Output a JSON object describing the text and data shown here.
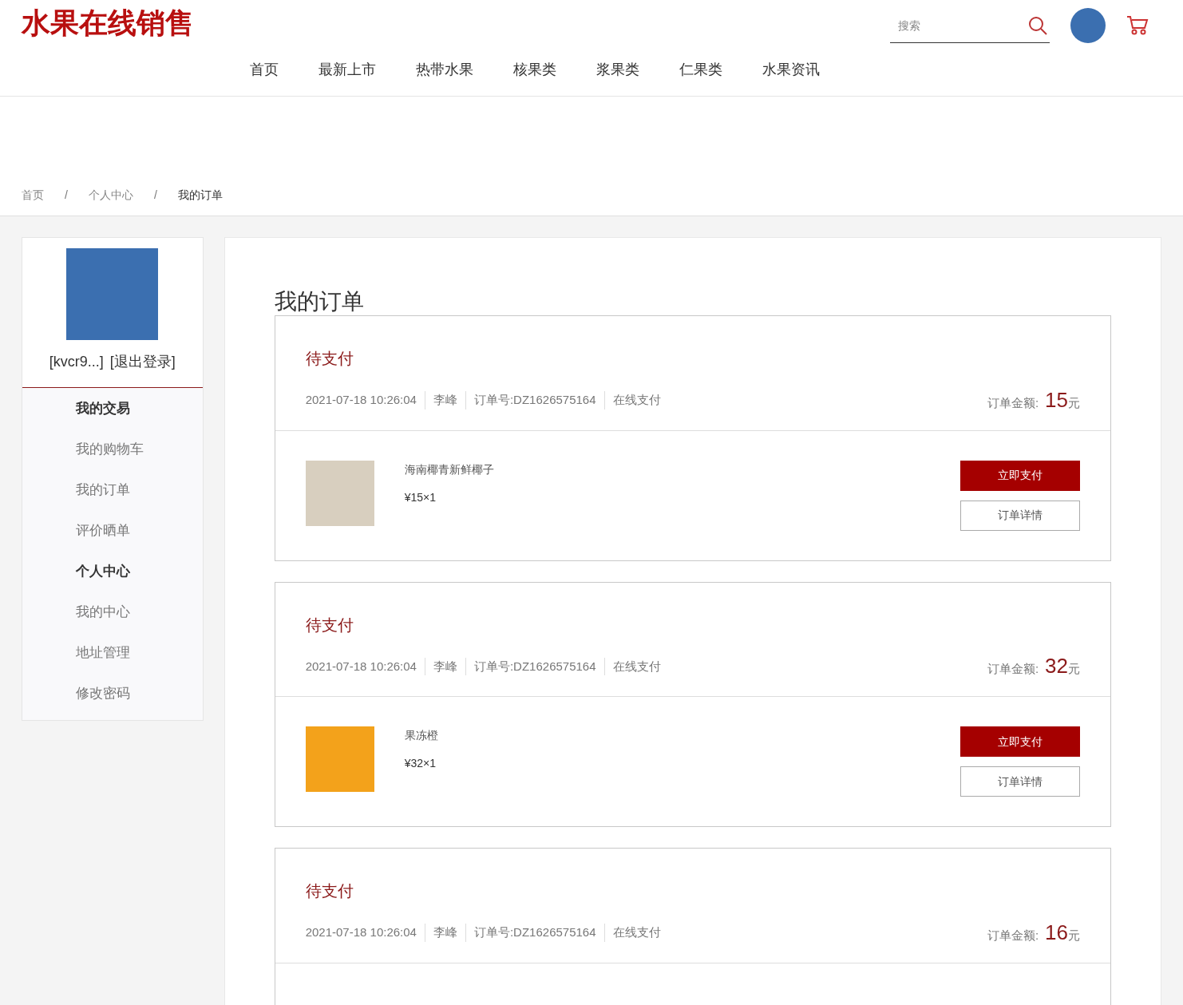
{
  "logo": "水果在线销售",
  "search": {
    "placeholder": "搜索"
  },
  "nav": [
    "首页",
    "最新上市",
    "热带水果",
    "核果类",
    "浆果类",
    "仁果类",
    "水果资讯"
  ],
  "breadcrumb": [
    {
      "label": "首页",
      "current": false
    },
    {
      "label": "个人中心",
      "current": false
    },
    {
      "label": "我的订单",
      "current": true
    }
  ],
  "breadcrumb_separators": [
    "/",
    "/"
  ],
  "user": {
    "name": "[kvcr9...]",
    "logout": "[退出登录]"
  },
  "sidebar": [
    {
      "title": "我的交易",
      "items": [
        "我的购物车",
        "我的订单",
        "评价晒单"
      ]
    },
    {
      "title": "个人中心",
      "items": [
        "我的中心",
        "地址管理",
        "修改密码"
      ]
    }
  ],
  "page_title": "我的订单",
  "orders": [
    {
      "status": "待支付",
      "time": "2021-07-18 10:26:04",
      "buyer": "李峰",
      "number": "订单号:DZ1626575164",
      "payment": "在线支付",
      "total_label": "订单金额:",
      "total": "15",
      "unit": "元",
      "items": [
        {
          "name": "海南椰青新鲜椰子",
          "price": "¥15×1",
          "kind": "coconut"
        }
      ],
      "pay_button": "立即支付",
      "detail_button": "订单详情"
    },
    {
      "status": "待支付",
      "time": "2021-07-18 10:26:04",
      "buyer": "李峰",
      "number": "订单号:DZ1626575164",
      "payment": "在线支付",
      "total_label": "订单金额:",
      "total": "32",
      "unit": "元",
      "items": [
        {
          "name": "果冻橙",
          "price": "¥32×1",
          "kind": "orange"
        }
      ],
      "pay_button": "立即支付",
      "detail_button": "订单详情"
    },
    {
      "status": "待支付",
      "time": "2021-07-18 10:26:04",
      "buyer": "李峰",
      "number": "订单号:DZ1626575164",
      "payment": "在线支付",
      "total_label": "订单金额:",
      "total": "16",
      "unit": "元"
    }
  ]
}
